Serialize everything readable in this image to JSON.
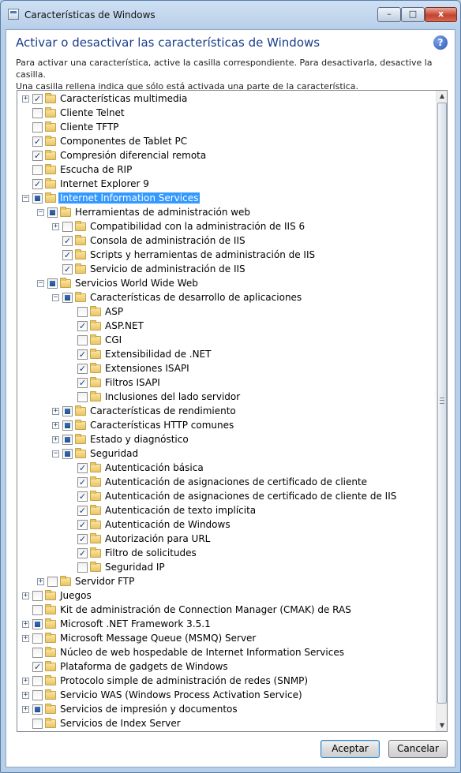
{
  "window": {
    "title": "Características de Windows",
    "controls": {
      "minimize": "–",
      "maximize": "□",
      "close": "x"
    }
  },
  "header": {
    "heading": "Activar o desactivar las características de Windows",
    "help_icon": "help-icon",
    "description_line1": "Para activar una característica, active la casilla correspondiente. Para desactivarla, desactive la casilla.",
    "description_line2": "Una casilla rellena indica que sólo está activada una parte de la característica."
  },
  "features": [
    {
      "label": "Características multimedia",
      "level": 0,
      "expander": "+",
      "state": "checked"
    },
    {
      "label": "Cliente Telnet",
      "level": 0,
      "expander": "",
      "state": "unchecked"
    },
    {
      "label": "Cliente TFTP",
      "level": 0,
      "expander": "",
      "state": "unchecked"
    },
    {
      "label": "Componentes de Tablet PC",
      "level": 0,
      "expander": "",
      "state": "checked"
    },
    {
      "label": "Compresión diferencial remota",
      "level": 0,
      "expander": "",
      "state": "checked"
    },
    {
      "label": "Escucha de RIP",
      "level": 0,
      "expander": "",
      "state": "unchecked"
    },
    {
      "label": "Internet Explorer 9",
      "level": 0,
      "expander": "",
      "state": "checked"
    },
    {
      "label": "Internet Information Services",
      "level": 0,
      "expander": "-",
      "state": "partial",
      "selected": true
    },
    {
      "label": "Herramientas de administración web",
      "level": 1,
      "expander": "-",
      "state": "partial"
    },
    {
      "label": "Compatibilidad con la administración de IIS 6",
      "level": 2,
      "expander": "+",
      "state": "unchecked"
    },
    {
      "label": "Consola de administración de IIS",
      "level": 2,
      "expander": "",
      "state": "checked"
    },
    {
      "label": "Scripts y herramientas de administración de IIS",
      "level": 2,
      "expander": "",
      "state": "checked"
    },
    {
      "label": "Servicio de administración de IIS",
      "level": 2,
      "expander": "",
      "state": "checked"
    },
    {
      "label": "Servicios World Wide Web",
      "level": 1,
      "expander": "-",
      "state": "partial"
    },
    {
      "label": "Características de desarrollo de aplicaciones",
      "level": 2,
      "expander": "-",
      "state": "partial"
    },
    {
      "label": "ASP",
      "level": 3,
      "expander": "",
      "state": "unchecked"
    },
    {
      "label": "ASP.NET",
      "level": 3,
      "expander": "",
      "state": "checked"
    },
    {
      "label": "CGI",
      "level": 3,
      "expander": "",
      "state": "unchecked"
    },
    {
      "label": "Extensibilidad de .NET",
      "level": 3,
      "expander": "",
      "state": "checked"
    },
    {
      "label": "Extensiones ISAPI",
      "level": 3,
      "expander": "",
      "state": "checked"
    },
    {
      "label": "Filtros ISAPI",
      "level": 3,
      "expander": "",
      "state": "checked"
    },
    {
      "label": "Inclusiones del lado servidor",
      "level": 3,
      "expander": "",
      "state": "unchecked"
    },
    {
      "label": "Características de rendimiento",
      "level": 2,
      "expander": "+",
      "state": "partial"
    },
    {
      "label": "Características HTTP comunes",
      "level": 2,
      "expander": "+",
      "state": "partial"
    },
    {
      "label": "Estado y diagnóstico",
      "level": 2,
      "expander": "+",
      "state": "partial"
    },
    {
      "label": "Seguridad",
      "level": 2,
      "expander": "-",
      "state": "partial"
    },
    {
      "label": "Autenticación básica",
      "level": 3,
      "expander": "",
      "state": "checked"
    },
    {
      "label": "Autenticación de asignaciones de certificado de cliente",
      "level": 3,
      "expander": "",
      "state": "checked"
    },
    {
      "label": "Autenticación de asignaciones de certificado de cliente de IIS",
      "level": 3,
      "expander": "",
      "state": "checked"
    },
    {
      "label": "Autenticación de texto implícita",
      "level": 3,
      "expander": "",
      "state": "checked"
    },
    {
      "label": "Autenticación de Windows",
      "level": 3,
      "expander": "",
      "state": "checked"
    },
    {
      "label": "Autorización para URL",
      "level": 3,
      "expander": "",
      "state": "checked"
    },
    {
      "label": "Filtro de solicitudes",
      "level": 3,
      "expander": "",
      "state": "checked"
    },
    {
      "label": "Seguridad IP",
      "level": 3,
      "expander": "",
      "state": "unchecked"
    },
    {
      "label": "Servidor FTP",
      "level": 1,
      "expander": "+",
      "state": "unchecked"
    },
    {
      "label": "Juegos",
      "level": 0,
      "expander": "+",
      "state": "unchecked"
    },
    {
      "label": "Kit de administración de Connection Manager (CMAK) de RAS",
      "level": 0,
      "expander": "",
      "state": "unchecked"
    },
    {
      "label": "Microsoft .NET Framework 3.5.1",
      "level": 0,
      "expander": "+",
      "state": "partial"
    },
    {
      "label": "Microsoft Message Queue (MSMQ) Server",
      "level": 0,
      "expander": "+",
      "state": "unchecked"
    },
    {
      "label": "Núcleo de web hospedable de Internet Information Services",
      "level": 0,
      "expander": "",
      "state": "unchecked"
    },
    {
      "label": "Plataforma de gadgets de Windows",
      "level": 0,
      "expander": "",
      "state": "checked"
    },
    {
      "label": "Protocolo simple de administración de redes (SNMP)",
      "level": 0,
      "expander": "+",
      "state": "unchecked"
    },
    {
      "label": "Servicio WAS (Windows Process Activation Service)",
      "level": 0,
      "expander": "+",
      "state": "unchecked"
    },
    {
      "label": "Servicios de impresión y documentos",
      "level": 0,
      "expander": "+",
      "state": "partial"
    },
    {
      "label": "Servicios de Index Server",
      "level": 0,
      "expander": "",
      "state": "unchecked"
    }
  ],
  "buttons": {
    "ok": "Aceptar",
    "cancel": "Cancelar"
  }
}
